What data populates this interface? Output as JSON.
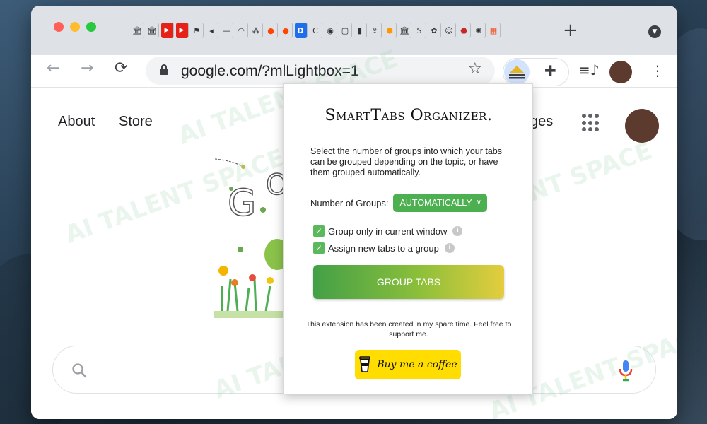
{
  "tabs": {
    "favicons": [
      "bank-icon",
      "bank-icon",
      "youtube-icon",
      "youtube-icon",
      "flag-icon",
      "audio-icon",
      "bar-icon",
      "rainbow-icon",
      "pattern-icon",
      "reddit-icon",
      "reddit-icon",
      "d-icon",
      "c-icon",
      "seal-icon",
      "frame-icon",
      "book-icon",
      "upload-icon",
      "shield-icon",
      "bank-icon",
      "s-icon",
      "flower-icon",
      "portrait-icon",
      "crest-icon",
      "openai-icon",
      "windows-icon"
    ],
    "new_tab_label": "+"
  },
  "toolbar": {
    "url": "google.com/?mlLightbox=1",
    "back_glyph": "←",
    "forward_glyph": "→",
    "reload_glyph": "⟳"
  },
  "google": {
    "about": "About",
    "store": "Store",
    "images_partial": "ges"
  },
  "popup": {
    "title": "SmartTabs Organizer.",
    "description": "Select the number of groups into which your tabs can be grouped depending on the topic, or have them grouped automatically.",
    "groups_label": "Number of Groups:",
    "groups_value": "AUTOMATICALLY",
    "option1_label": "Group only in current window",
    "option2_label": "Assign new tabs to a group",
    "option1_checked": true,
    "option2_checked": true,
    "group_button": "GROUP TABS",
    "footer": "This extension has been created in my spare time. Feel free to support me.",
    "coffee_button": "Buy me a coffee"
  },
  "watermark": "AI TALENT SPACE",
  "colors": {
    "select_green": "#4caf50",
    "coffee_yellow": "#ffdd00",
    "avatar_brown": "#5c3a2e"
  }
}
